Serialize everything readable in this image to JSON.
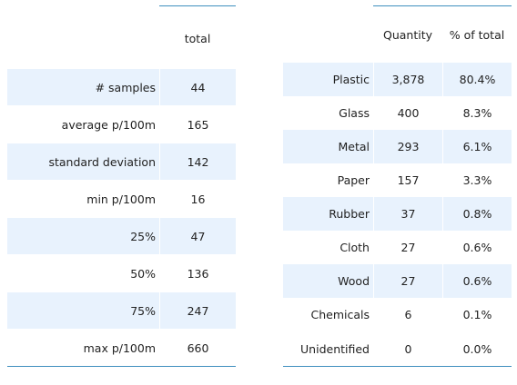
{
  "summary_table": {
    "header": [
      "",
      "total"
    ],
    "rows": [
      {
        "label": "# samples",
        "value": "44"
      },
      {
        "label": "average p/100m",
        "value": "165"
      },
      {
        "label": "standard deviation",
        "value": "142"
      },
      {
        "label": "min p/100m",
        "value": "16"
      },
      {
        "label": "25%",
        "value": "47"
      },
      {
        "label": "50%",
        "value": "136"
      },
      {
        "label": "75%",
        "value": "247"
      },
      {
        "label": "max p/100m",
        "value": "660"
      }
    ]
  },
  "material_table": {
    "header": [
      "",
      "Quantity",
      "% of total"
    ],
    "rows": [
      {
        "material": "Plastic",
        "quantity": "3,878",
        "percent": "80.4%"
      },
      {
        "material": "Glass",
        "quantity": "400",
        "percent": "8.3%"
      },
      {
        "material": "Metal",
        "quantity": "293",
        "percent": "6.1%"
      },
      {
        "material": "Paper",
        "quantity": "157",
        "percent": "3.3%"
      },
      {
        "material": "Rubber",
        "quantity": "37",
        "percent": "0.8%"
      },
      {
        "material": "Cloth",
        "quantity": "27",
        "percent": "0.6%"
      },
      {
        "material": "Wood",
        "quantity": "27",
        "percent": "0.6%"
      },
      {
        "material": "Chemicals",
        "quantity": "6",
        "percent": "0.1%"
      },
      {
        "material": "Unidentified",
        "quantity": "0",
        "percent": "0.0%"
      }
    ]
  },
  "colors": {
    "band": "#e8f2fd",
    "rule": "#3f8fbf",
    "text": "#222222"
  }
}
